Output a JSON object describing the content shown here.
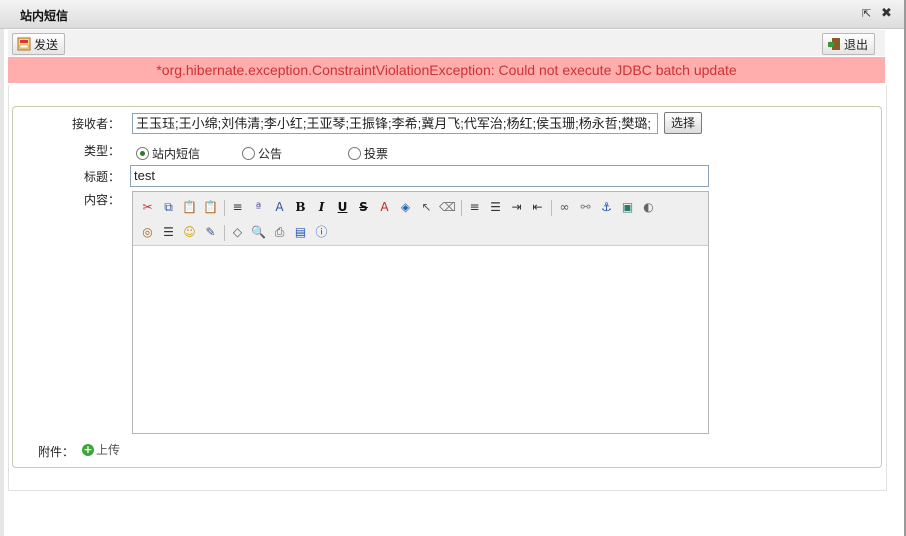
{
  "window": {
    "title": "站内短信",
    "popout_icon": "popout-icon",
    "close_icon": "close-icon"
  },
  "toolbar": {
    "send_label": "发送",
    "exit_label": "退出"
  },
  "alert": {
    "message": "*org.hibernate.exception.ConstraintViolationException: Could not execute JDBC batch update",
    "bg_color": "#ffadad",
    "text_color": "#cc3333"
  },
  "form": {
    "recipients_label": "接收者：",
    "recipients_value": "王玉珏;王小绵;刘伟清;李小红;王亚琴;王振锋;李希;冀月飞;代军治;杨红;侯玉珊;杨永哲;樊璐;",
    "select_label": "选择",
    "type_label": "类型：",
    "types": [
      {
        "label": "站内短信",
        "checked": true
      },
      {
        "label": "公告",
        "checked": false
      },
      {
        "label": "投票",
        "checked": false
      }
    ],
    "subject_label": "标题：",
    "subject_value": "test",
    "content_label": "内容：",
    "attachment_label": "附件：",
    "upload_label": "上传"
  },
  "editor": {
    "row1": [
      {
        "name": "cut-icon",
        "glyph": "✂",
        "color": "#cc3333"
      },
      {
        "name": "copy-icon",
        "glyph": "⧉",
        "color": "#335599"
      },
      {
        "name": "paste-icon",
        "glyph": "📋",
        "color": "#9a6a2a"
      },
      {
        "name": "paste-text-icon",
        "glyph": "📋",
        "color": "#9a6a2a"
      },
      {
        "sep": true
      },
      {
        "name": "format-paragraph-icon",
        "glyph": "≡",
        "color": "#333333"
      },
      {
        "name": "spellcheck-icon",
        "glyph": "ª",
        "color": "#5555aa"
      },
      {
        "name": "font-size-icon",
        "glyph": "A",
        "color": "#335599"
      },
      {
        "name": "bold-icon",
        "glyph": "B",
        "color": "#111111",
        "bold": true
      },
      {
        "name": "italic-icon",
        "glyph": "I",
        "color": "#111111",
        "italic": true
      },
      {
        "name": "underline-icon",
        "glyph": "U",
        "color": "#111111",
        "underline": true
      },
      {
        "name": "strikethrough-icon",
        "glyph": "S",
        "color": "#111111",
        "strike": true
      },
      {
        "name": "font-color-icon",
        "glyph": "A",
        "color": "#cc2222"
      },
      {
        "name": "highlight-color-icon",
        "glyph": "◈",
        "color": "#2266aa"
      },
      {
        "name": "select-pointer-icon",
        "glyph": "↖",
        "color": "#555555"
      },
      {
        "name": "eraser-icon",
        "glyph": "⌫",
        "color": "#777777"
      },
      {
        "sep": true
      },
      {
        "name": "align-left-icon",
        "glyph": "≡",
        "color": "#333333"
      },
      {
        "name": "list-icon",
        "glyph": "☰",
        "color": "#333333"
      },
      {
        "name": "indent-icon",
        "glyph": "⇥",
        "color": "#333333"
      },
      {
        "name": "outdent-icon",
        "glyph": "⇤",
        "color": "#333333"
      },
      {
        "sep": true
      },
      {
        "name": "link-icon",
        "glyph": "∞",
        "color": "#555555"
      },
      {
        "name": "unlink-icon",
        "glyph": "⚯",
        "color": "#777777"
      },
      {
        "name": "anchor-icon",
        "glyph": "⚓",
        "color": "#2255aa"
      },
      {
        "name": "image-icon",
        "glyph": "▣",
        "color": "#2a7a6a"
      },
      {
        "name": "flash-icon",
        "glyph": "◐",
        "color": "#666666"
      }
    ],
    "row2": [
      {
        "name": "media-icon",
        "glyph": "◎",
        "color": "#a86a1a"
      },
      {
        "name": "horizontal-rule-icon",
        "glyph": "☰",
        "color": "#333333"
      },
      {
        "name": "emoticon-icon",
        "glyph": "☺",
        "color": "#d4a000"
      },
      {
        "name": "edit-icon",
        "glyph": "✎",
        "color": "#445588"
      },
      {
        "sep": true
      },
      {
        "name": "source-code-icon",
        "glyph": "◇",
        "color": "#555555"
      },
      {
        "name": "preview-icon",
        "glyph": "🔍",
        "color": "#555555"
      },
      {
        "name": "print-icon",
        "glyph": "⎙",
        "color": "#555555"
      },
      {
        "name": "fullscreen-icon",
        "glyph": "▤",
        "color": "#2255aa"
      },
      {
        "name": "about-icon",
        "glyph": "ⓘ",
        "color": "#2255aa"
      }
    ]
  }
}
